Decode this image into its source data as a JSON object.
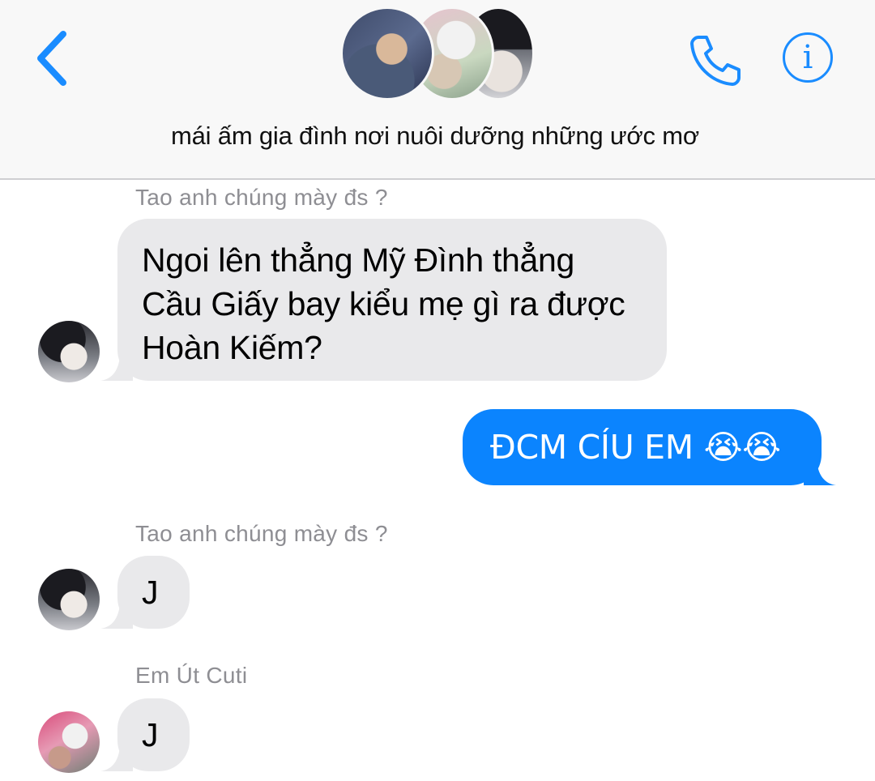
{
  "header": {
    "title": "mái ấm gia đình nơi nuôi dưỡng những ước mơ",
    "back_icon": "chevron-left-icon",
    "call_icon": "phone-icon",
    "info_icon": "info-icon",
    "info_glyph": "i",
    "accent_color": "#1a8cff"
  },
  "messages": [
    {
      "sender": "Tao anh chúng mày đs ?",
      "text": "Ngoi lên thẳng Mỹ Đình thẳng Cầu Giấy bay kiểu mẹ gì ra được Hoàn Kiếm?",
      "direction": "incoming"
    },
    {
      "text": "ĐCM CÍU EM 😭😭",
      "direction": "outgoing"
    },
    {
      "sender": "Tao anh chúng mày đs ?",
      "text": "J",
      "direction": "incoming"
    },
    {
      "sender": "Em Út Cuti",
      "text": "J",
      "direction": "incoming"
    }
  ],
  "colors": {
    "incoming_bubble": "#e9e9eb",
    "outgoing_bubble": "#0b84fe",
    "sender_label": "#8e8e93"
  }
}
